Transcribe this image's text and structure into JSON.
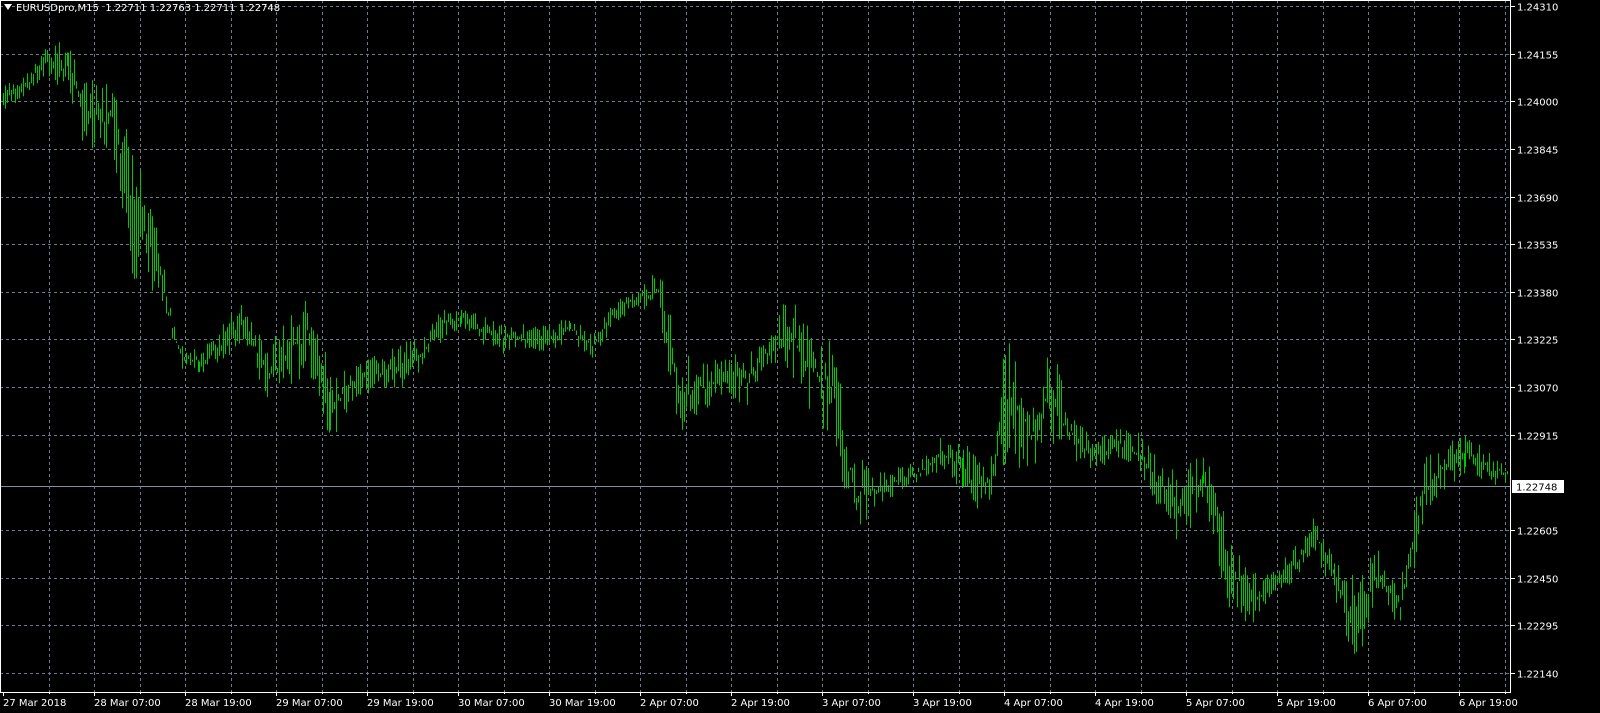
{
  "header": {
    "symbol": "EURUSDpro,M15",
    "ohlc": "1.22711 1.22763 1.22711 1.22748"
  },
  "chart_data": {
    "type": "bar",
    "style": "OHLC bars",
    "timeframe": "M15",
    "ylim": [
      1.2214,
      1.2431
    ],
    "grid": true,
    "yticks": [
      "1.24310",
      "1.24155",
      "1.24000",
      "1.23845",
      "1.23690",
      "1.23535",
      "1.23380",
      "1.23225",
      "1.23070",
      "1.22915",
      "1.22605",
      "1.22450",
      "1.22295",
      "1.22140"
    ],
    "xticks": [
      "27 Mar 2018",
      "28 Mar 07:00",
      "28 Mar 19:00",
      "29 Mar 07:00",
      "29 Mar 19:00",
      "30 Mar 07:00",
      "30 Mar 19:00",
      "2 Apr 07:00",
      "2 Apr 19:00",
      "3 Apr 07:00",
      "3 Apr 19:00",
      "4 Apr 07:00",
      "4 Apr 19:00",
      "5 Apr 07:00",
      "5 Apr 19:00",
      "6 Apr 07:00",
      "6 Apr 19:00"
    ],
    "current_price": "1.22748",
    "high_low": [
      [
        1.24055,
        1.23959
      ],
      [
        1.24087,
        1.24023
      ],
      [
        1.24183,
        1.24071
      ],
      [
        1.24208,
        1.24023
      ],
      [
        1.24071,
        1.23784
      ],
      [
        1.24055,
        1.23848
      ],
      [
        1.23848,
        1.23402
      ],
      [
        1.23593,
        1.2337
      ],
      [
        1.23242,
        1.23131
      ],
      [
        1.23179,
        1.23115
      ],
      [
        1.23274,
        1.23147
      ],
      [
        1.23354,
        1.23227
      ],
      [
        1.23211,
        1.23019
      ],
      [
        1.23306,
        1.23051
      ],
      [
        1.2337,
        1.23115
      ],
      [
        1.23115,
        1.22892
      ],
      [
        1.23131,
        1.23019
      ],
      [
        1.23179,
        1.23051
      ],
      [
        1.23211,
        1.23051
      ],
      [
        1.23227,
        1.23115
      ],
      [
        1.23322,
        1.23211
      ],
      [
        1.23322,
        1.23274
      ],
      [
        1.23306,
        1.23211
      ],
      [
        1.2329,
        1.23179
      ],
      [
        1.23274,
        1.23195
      ],
      [
        1.23274,
        1.23179
      ],
      [
        1.23306,
        1.23227
      ],
      [
        1.23242,
        1.23163
      ],
      [
        1.23354,
        1.23274
      ],
      [
        1.23386,
        1.23338
      ],
      [
        1.23466,
        1.23274
      ],
      [
        1.23211,
        1.22892
      ],
      [
        1.23147,
        1.22988
      ],
      [
        1.23179,
        1.23051
      ],
      [
        1.23179,
        1.22988
      ],
      [
        1.23227,
        1.23147
      ],
      [
        1.23386,
        1.23115
      ],
      [
        1.23274,
        1.22988
      ],
      [
        1.23211,
        1.22892
      ],
      [
        1.2286,
        1.22605
      ],
      [
        1.22796,
        1.22669
      ],
      [
        1.22812,
        1.22733
      ],
      [
        1.22828,
        1.22765
      ],
      [
        1.22924,
        1.22796
      ],
      [
        1.22892,
        1.22733
      ],
      [
        1.22828,
        1.22637
      ],
      [
        1.23258,
        1.22828
      ],
      [
        1.23051,
        1.22796
      ],
      [
        1.23211,
        1.22892
      ],
      [
        1.22988,
        1.22828
      ],
      [
        1.22892,
        1.22796
      ],
      [
        1.2294,
        1.22844
      ],
      [
        1.22924,
        1.22796
      ],
      [
        1.22828,
        1.22669
      ],
      [
        1.22796,
        1.22541
      ],
      [
        1.22876,
        1.22733
      ],
      [
        1.22669,
        1.2235
      ],
      [
        1.22478,
        1.22255
      ],
      [
        1.22478,
        1.22382
      ],
      [
        1.22541,
        1.22414
      ],
      [
        1.22653,
        1.22541
      ],
      [
        1.2251,
        1.22382
      ],
      [
        1.22478,
        1.22159
      ],
      [
        1.22541,
        1.22414
      ],
      [
        1.22446,
        1.22271
      ],
      [
        1.22844,
        1.22605
      ],
      [
        1.22876,
        1.22733
      ],
      [
        1.2294,
        1.22796
      ],
      [
        1.2286,
        1.22765
      ],
      [
        1.22828,
        1.22733
      ]
    ]
  },
  "colors": {
    "background": "#000000",
    "bars": "#00c800",
    "grid": "#6b7b8c",
    "current_price_line": "#8090a0",
    "axis": "#ffffff"
  }
}
